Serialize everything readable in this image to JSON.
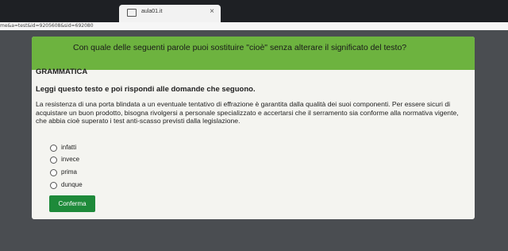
{
  "browser": {
    "tab_title": "aula01.it",
    "tab_close": "×",
    "url": "me&a=test&id=9205608&sid=692080"
  },
  "question": {
    "text": "Con quale delle seguenti parole puoi sostituire \"cioè\" senza alterare il significato del testo?"
  },
  "content": {
    "section_label": "GRAMMATICA",
    "instruction": "Leggi questo testo e poi rispondi alle domande che seguono.",
    "passage": "La resistenza di una porta blindata a un eventuale tentativo di effrazione è garantita dalla qualità dei suoi componenti. Per essere sicuri di acquistare un buon prodotto, bisogna rivolgersi a personale specializzato e accertarsi che il serramento sia conforme alla normativa vigente, che abbia cioè superato i test anti-scasso previsti dalla legislazione."
  },
  "options": [
    {
      "label": "infatti"
    },
    {
      "label": "invece"
    },
    {
      "label": "prima"
    },
    {
      "label": "dunque"
    }
  ],
  "actions": {
    "confirm_label": "Conferma"
  },
  "colors": {
    "question_bar": "#6db33f",
    "confirm_button": "#1e8a3a"
  }
}
